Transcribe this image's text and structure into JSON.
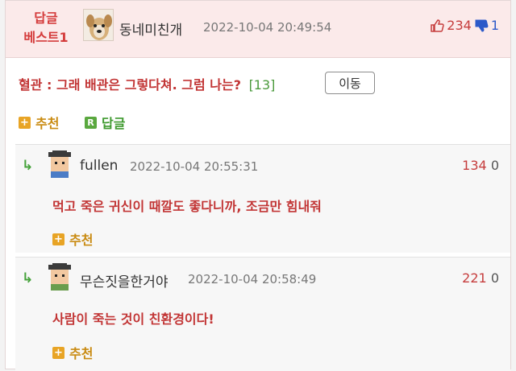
{
  "best": {
    "label_line1": "답글",
    "label_line2": "베스트1",
    "author": "동네미친개",
    "time": "2022-10-04 20:49:54",
    "up_count": "234",
    "down_count": "1",
    "body": "혈관 : 그래 배관은 그렇다쳐. 그럼 나는?",
    "reply_count": "[13]",
    "move_button": "이동",
    "recommend_label": "추천",
    "reply_label": "답글",
    "reply_badge": "R"
  },
  "replies": [
    {
      "author": "fullen",
      "time": "2022-10-04 20:55:31",
      "up": "134",
      "down": "0",
      "text": "먹고 죽은 귀신이 때깔도 좋다니까, 조금만 힘내줘",
      "recommend_label": "추천"
    },
    {
      "author": "무슨짓을한거야",
      "time": "2022-10-04 20:58:49",
      "up": "221",
      "down": "0",
      "text": "사람이 죽는 것이 친환경이다!",
      "recommend_label": "추천"
    }
  ],
  "icons": {
    "reply_arrow": "reply-arrow-icon",
    "plus": "+"
  },
  "colors": {
    "accent_red": "#c23535",
    "header_bg": "#fbeaea",
    "green": "#44a23a",
    "orange": "#e8a425"
  }
}
